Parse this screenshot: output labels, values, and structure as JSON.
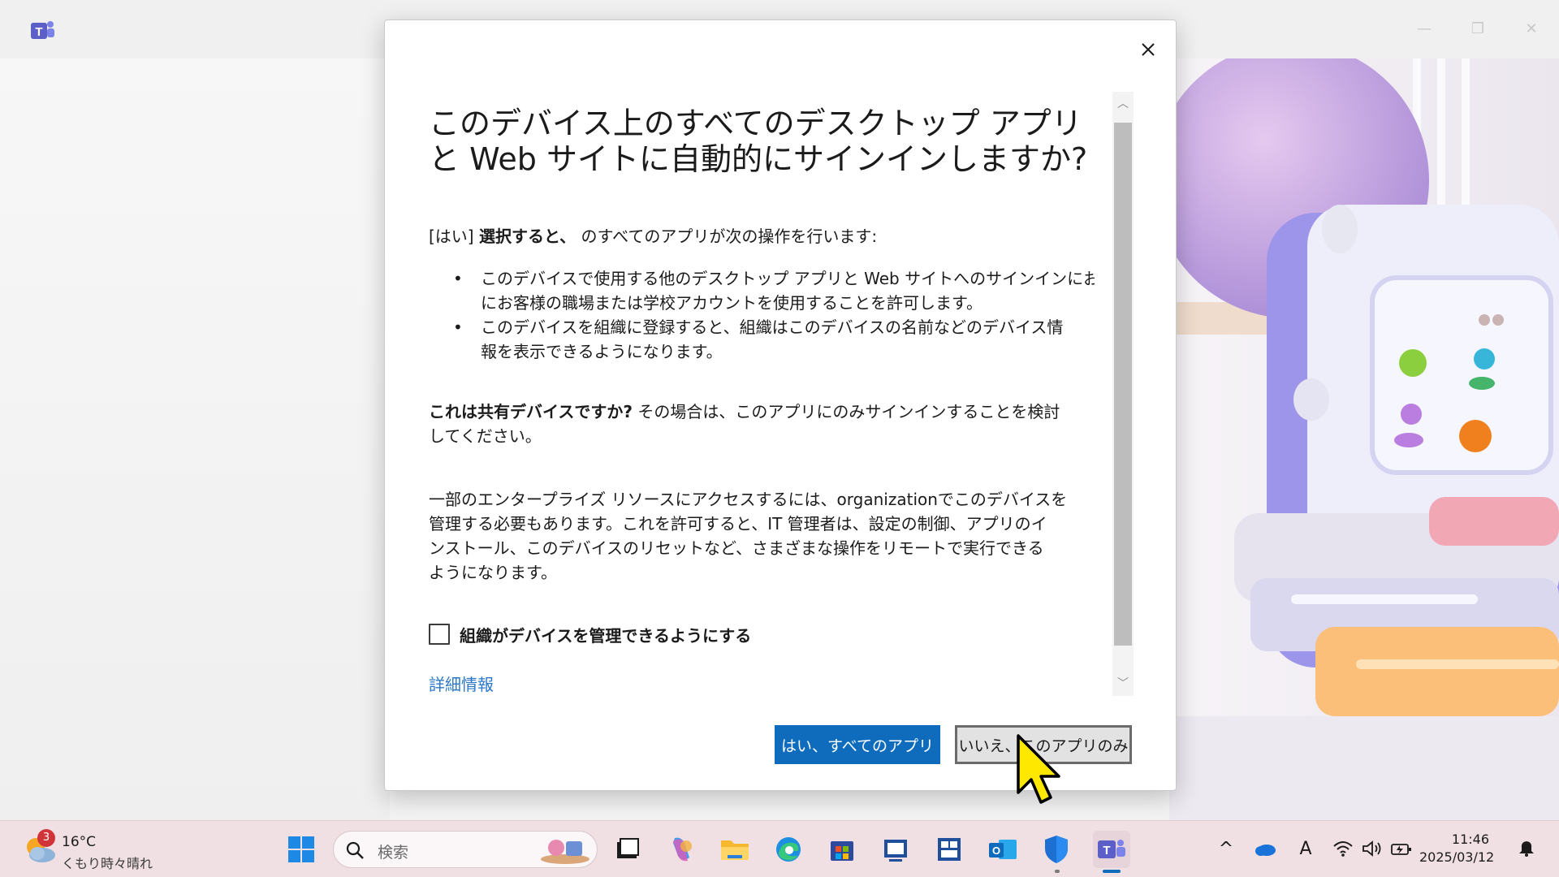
{
  "window": {
    "title_app": "Microsoft Teams",
    "controls": {
      "minimize": "—",
      "maximize": "❐",
      "close": "✕"
    }
  },
  "dialog": {
    "title": "このデバイス上のすべてのデスクトップ アプリと Web サイトに自動的にサインインしますか?",
    "intro_prefix": "[はい]",
    "intro_bold": "選択すると、",
    "intro_suffix": "のすべてのアプリが次の操作を行います:",
    "bullets": [
      {
        "line1": "このデバイスで使用する他のデスクトップ アプリと Web サイトへのサインインにお客様の",
        "line2": "にお客様の職場または学校アカウントを使用することを許可します。"
      },
      {
        "line1": "このデバイスを組織に登録すると、組織はこのデバイスの名前などのデバイス情",
        "line2": "報を表示できるようになります。"
      }
    ],
    "shared_bold": "これは共有デバイスですか?",
    "shared_line1": "その場合は、このアプリにのみサインインすることを検討",
    "shared_line2": "してください。",
    "enterprise_lines": [
      "一部のエンタープライズ リソースにアクセスするには、organizationでこのデバイスを",
      "管理する必要もあります。これを許可すると、IT 管理者は、設定の制御、アプリのイ",
      "ンストール、このデバイスのリセットなど、さまざまな操作をリモートで実行できる",
      "ようになります。"
    ],
    "checkbox_label": "組織がデバイスを管理できるようにする",
    "checkbox_checked": false,
    "more_info": "詳細情報",
    "yes_button": "はい、すべてのアプリ",
    "no_button": "いいえ、このアプリのみ"
  },
  "taskbar": {
    "weather": {
      "badge": "3",
      "temp": "16°C",
      "desc": "くもり時々晴れ"
    },
    "search_placeholder": "検索",
    "pinned": [
      "start-icon",
      "search",
      "task-view-icon",
      "copilot-icon",
      "file-explorer-icon",
      "edge-icon",
      "microsoft-store-icon",
      "remote-desktop-icon",
      "widgets-board-icon",
      "outlook-icon",
      "windows-security-icon",
      "teams-icon"
    ],
    "tray": {
      "show_hidden": "^",
      "ime": "A",
      "time": "11:46",
      "date": "2025/03/12"
    }
  },
  "colors": {
    "accent": "#0f6cbd",
    "link": "#2a77c9",
    "taskbar": "#f0dfe3",
    "badge": "#d13438"
  }
}
